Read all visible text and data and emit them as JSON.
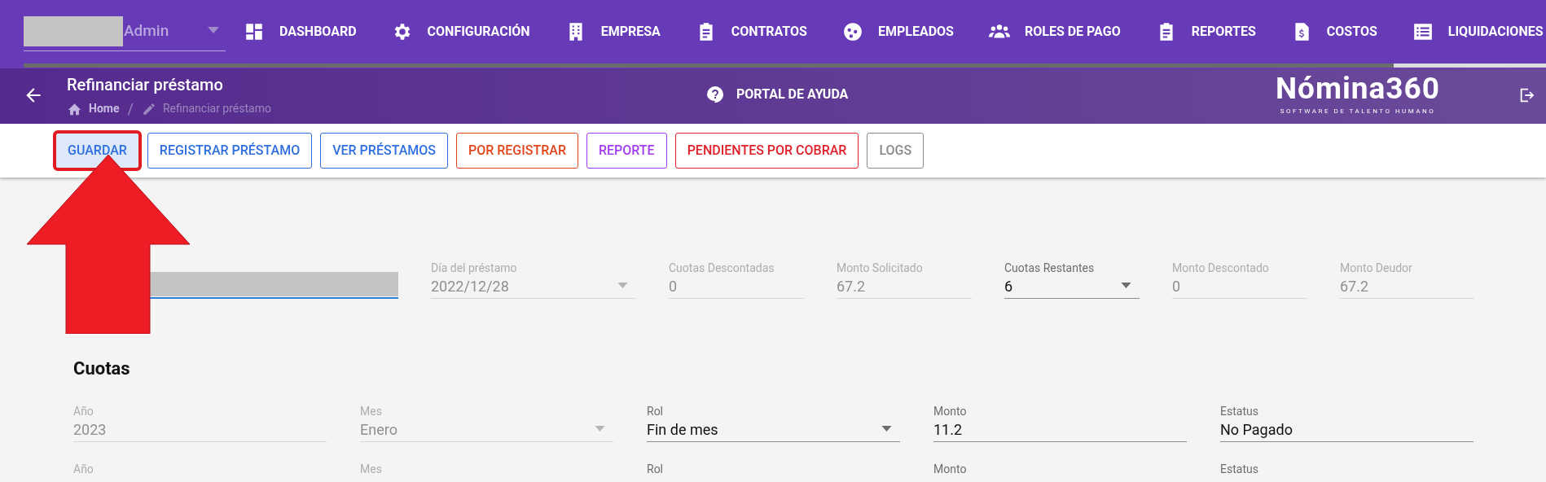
{
  "top_bar": {
    "user_select": {
      "value": "Admin"
    },
    "nav": [
      {
        "label": "DASHBOARD"
      },
      {
        "label": "CONFIGURACIÓN"
      },
      {
        "label": "EMPRESA"
      },
      {
        "label": "CONTRATOS"
      },
      {
        "label": "EMPLEADOS"
      },
      {
        "label": "ROLES DE PAGO"
      },
      {
        "label": "REPORTES"
      },
      {
        "label": "COSTOS"
      },
      {
        "label": "LIQUIDACIONES"
      }
    ],
    "progress": {
      "level": 0.9
    }
  },
  "header": {
    "title": "Refinanciar préstamo",
    "breadcrumb": [
      "Home",
      "Refinanciar préstamo"
    ],
    "breadcrumb_separator": "/",
    "help_link": "PORTAL DE AYUDA",
    "logo": {
      "name": "Nómina360",
      "tagline": "SOFTWARE DE TALENTO HUMANO"
    }
  },
  "toolbar": [
    {
      "label": "GUARDAR",
      "color": "#2f6fe0",
      "selected": true
    },
    {
      "label": "REGISTRAR PRÉSTAMO",
      "color": "#2f6fe0",
      "selected": false
    },
    {
      "label": "VER PRÉSTAMOS",
      "color": "#2f6fe0",
      "selected": false
    },
    {
      "label": "POR REGISTRAR",
      "color": "#e2451c",
      "selected": false
    },
    {
      "label": "REPORTE",
      "color": "#a23cf0",
      "selected": false
    },
    {
      "label": "PENDIENTES POR COBRAR",
      "color": "#e0202a",
      "selected": false
    },
    {
      "label": "LOGS",
      "color": "#8a8a8a",
      "selected": false
    }
  ],
  "loan_fields": [
    {
      "kind": "redacted"
    },
    {
      "kind": "select",
      "label": "Día del préstamo",
      "value": "2022/12/28",
      "disabled": true
    },
    {
      "kind": "text",
      "label": "Cuotas Descontadas",
      "value": "0",
      "disabled": true
    },
    {
      "kind": "text",
      "label": "Monto Solicitado",
      "value": "67.2",
      "disabled": true
    },
    {
      "kind": "select",
      "label": "Cuotas Restantes",
      "value": "6",
      "disabled": false
    },
    {
      "kind": "text",
      "label": "Monto Descontado",
      "value": "0",
      "disabled": true
    },
    {
      "kind": "text",
      "label": "Monto Deudor",
      "value": "67.2",
      "disabled": true
    }
  ],
  "cuotas": {
    "title": "Cuotas",
    "rows": [
      [
        {
          "kind": "text",
          "label": "Año",
          "value": "2023",
          "disabled": true
        },
        {
          "kind": "select",
          "label": "Mes",
          "value": "Enero",
          "disabled": true
        },
        {
          "kind": "select",
          "label": "Rol",
          "value": "Fin de mes",
          "disabled": false
        },
        {
          "kind": "text",
          "label": "Monto",
          "value": "11.2",
          "disabled": false
        },
        {
          "kind": "text",
          "label": "Estatus",
          "value": "No Pagado",
          "disabled": false
        }
      ],
      [
        {
          "kind": "text",
          "label": "Año",
          "disabled": true
        },
        {
          "kind": "select",
          "label": "Mes",
          "disabled": true
        },
        {
          "kind": "select",
          "label": "Rol",
          "disabled": false
        },
        {
          "kind": "text",
          "label": "Monto",
          "disabled": false
        },
        {
          "kind": "text",
          "label": "Estatus",
          "disabled": false
        }
      ]
    ]
  }
}
